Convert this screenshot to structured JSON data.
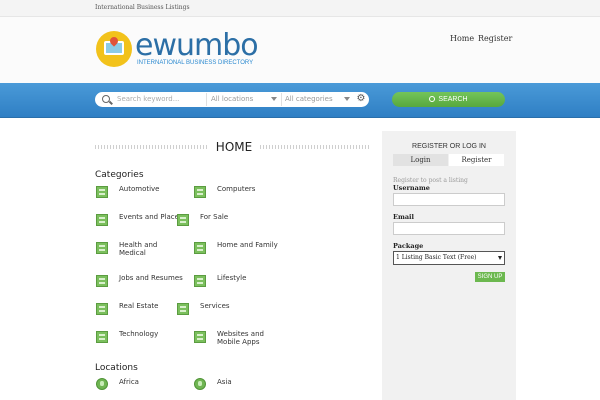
{
  "topbar": {
    "text": "International Business Listings"
  },
  "logo": {
    "word": "ewumbo",
    "tagline": "INTERNATIONAL BUSINESS DIRECTORY"
  },
  "nav": {
    "items": [
      "Home",
      "Register"
    ]
  },
  "search": {
    "keyword_placeholder": "Search keyword...",
    "location_value": "All locations",
    "category_value": "All categories",
    "button_label": "SEARCH"
  },
  "main": {
    "title": "HOME",
    "categories_heading": "Categories",
    "categories": [
      "Automotive",
      "Computers",
      "Events and Places",
      "For Sale",
      "Health and Medical",
      "Home and Family",
      "Jobs and Resumes",
      "Lifestyle",
      "Real Estate",
      "Services",
      "Technology",
      "Websites and Mobile Apps"
    ],
    "locations_heading": "Locations",
    "locations": [
      "Africa",
      "Asia"
    ]
  },
  "panel": {
    "title": "REGISTER OR LOG IN",
    "tabs": [
      "Login",
      "Register"
    ],
    "note": "Register to post a listing",
    "username_label": "Username",
    "email_label": "Email",
    "package_label": "Package",
    "package_value": "1 Listing Basic Text (Free)",
    "signup_label": "SIGN UP"
  },
  "colors": {
    "brand_blue": "#2f7fc4",
    "accent_green": "#6cb84f",
    "logo_yellow": "#f2c21b"
  }
}
